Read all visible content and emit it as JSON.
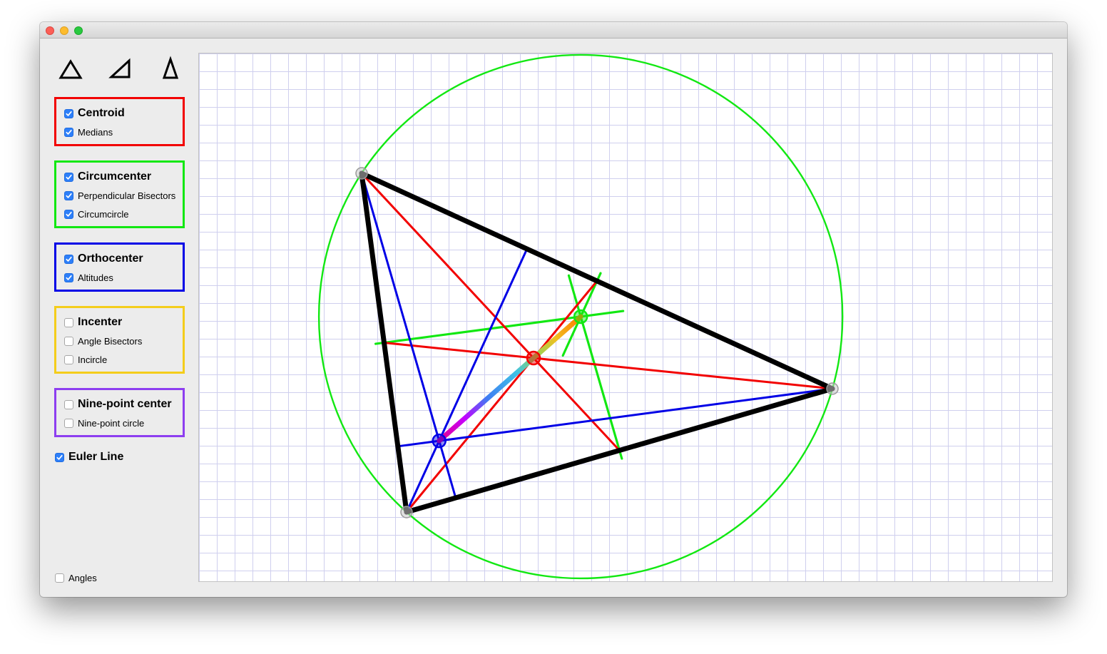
{
  "window": {
    "controls": [
      "close",
      "minimize",
      "zoom"
    ]
  },
  "sidebar": {
    "shape_buttons": [
      "equilateral-triangle-icon",
      "right-triangle-icon",
      "isosceles-triangle-icon"
    ],
    "groups": {
      "centroid": {
        "color": "#f20000",
        "title": "Centroid",
        "checked": true,
        "options": [
          {
            "label": "Medians",
            "checked": true
          }
        ]
      },
      "circumcenter": {
        "color": "#12e812",
        "title": "Circumcenter",
        "checked": true,
        "options": [
          {
            "label": "Perpendicular Bisectors",
            "checked": true
          },
          {
            "label": "Circumcircle",
            "checked": true
          }
        ]
      },
      "orthocenter": {
        "color": "#0000e6",
        "title": "Orthocenter",
        "checked": true,
        "options": [
          {
            "label": "Altitudes",
            "checked": true
          }
        ]
      },
      "incenter": {
        "color": "#f4cd1b",
        "title": "Incenter",
        "checked": false,
        "options": [
          {
            "label": "Angle Bisectors",
            "checked": false
          },
          {
            "label": "Incircle",
            "checked": false
          }
        ]
      },
      "ninepoint": {
        "color": "#8d3ef0",
        "title": "Nine-point center",
        "checked": false,
        "options": [
          {
            "label": "Nine-point circle",
            "checked": false
          }
        ]
      }
    },
    "euler_line": {
      "label": "Euler Line",
      "checked": true
    },
    "angles": {
      "label": "Angles",
      "checked": false
    }
  },
  "canvas": {
    "colors": {
      "triangle": "#000000",
      "medians": "#f20000",
      "bisectors": "#12e812",
      "altitudes": "#0000e6",
      "circumcircle": "#12e812"
    }
  }
}
